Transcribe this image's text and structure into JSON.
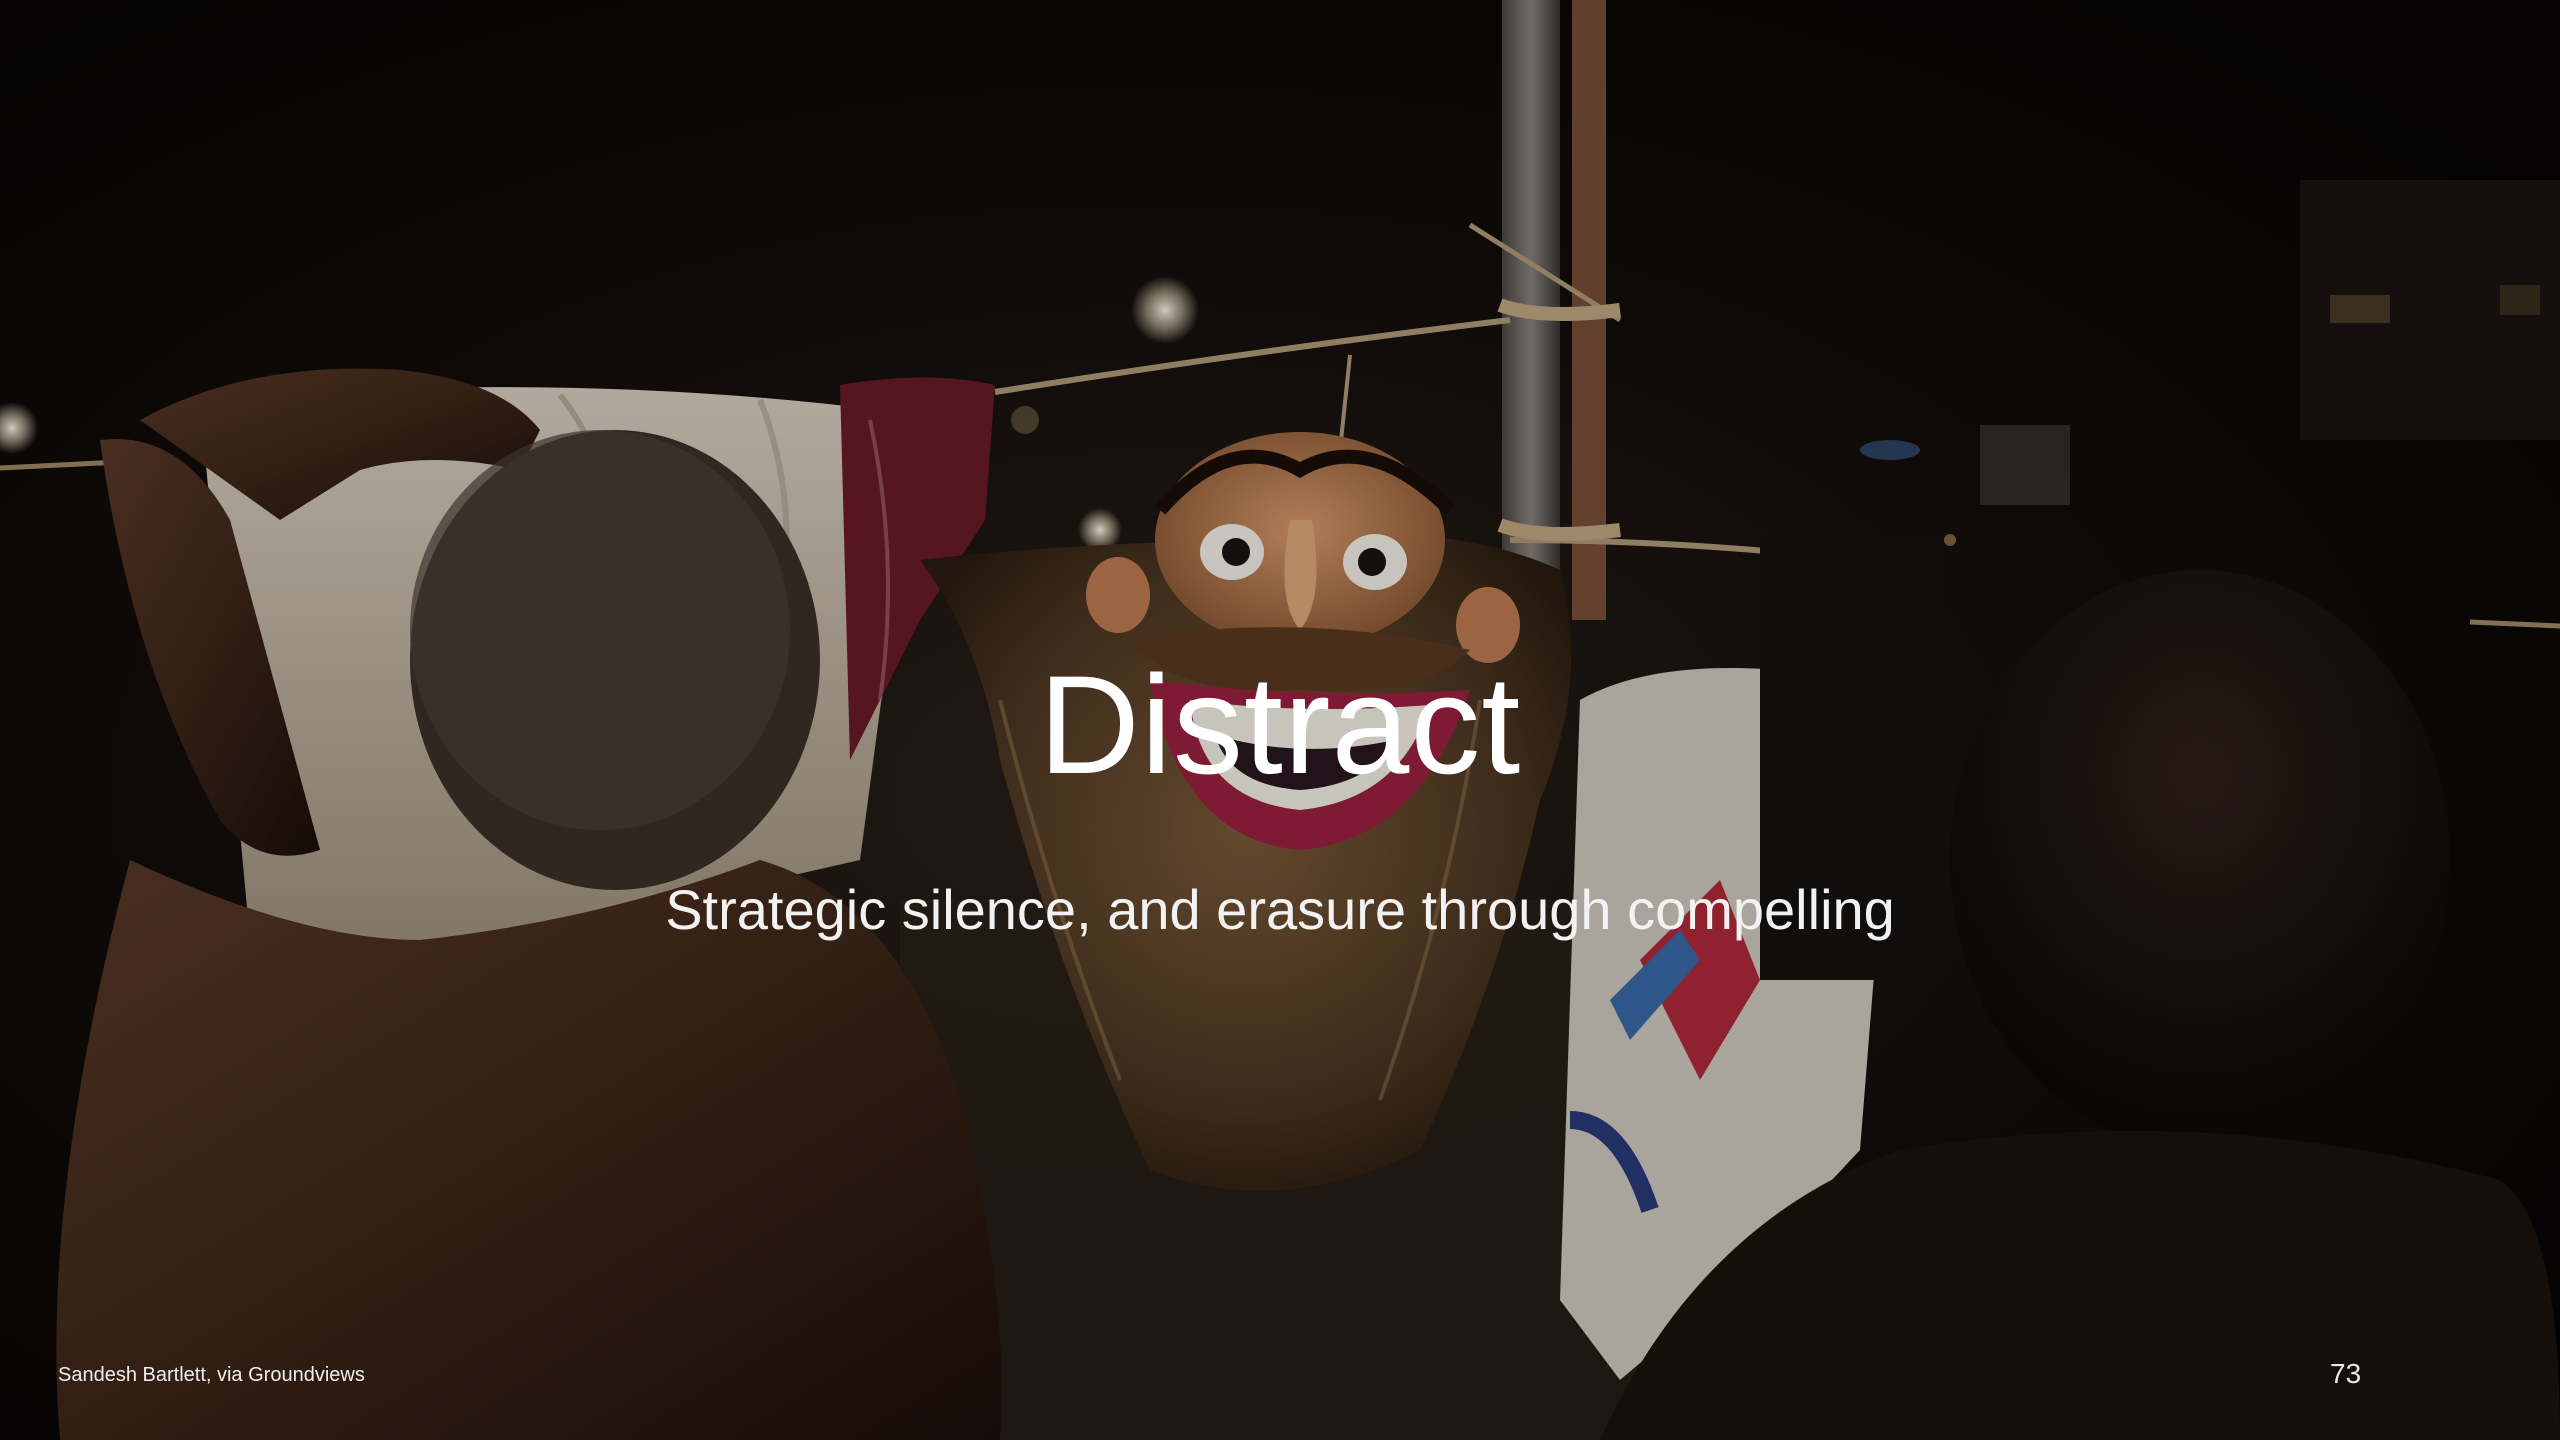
{
  "slide": {
    "title": "Distract",
    "subtitle": "Strategic silence, and erasure through compelling",
    "credit": "Sandesh Bartlett, via Groundviews",
    "page_number": "73"
  },
  "photo": {
    "subject": "night-scene-with-mask"
  },
  "colors": {
    "background": "#070505",
    "text": "#ffffff"
  }
}
